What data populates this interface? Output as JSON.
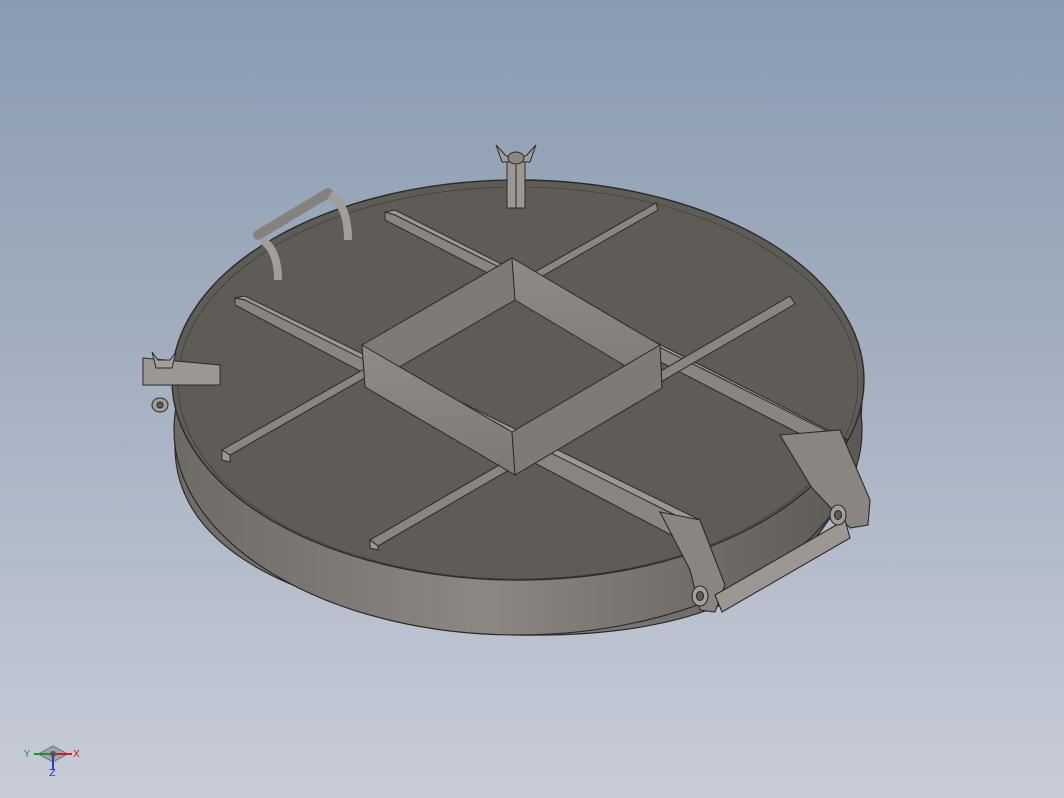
{
  "viewport": {
    "background_top": "#8a9bb0",
    "background_bottom": "#c8ccd8"
  },
  "model": {
    "face_color": "#5f5b57",
    "edge_color": "#2c2a28",
    "side_color": "#8a8580",
    "rib_face_color": "#8a8580"
  },
  "triad": {
    "x_label": "X",
    "y_label": "Y",
    "z_label": "Z",
    "x_color": "#d02020",
    "y_color": "#1a9a1a",
    "z_color": "#2040c0"
  }
}
